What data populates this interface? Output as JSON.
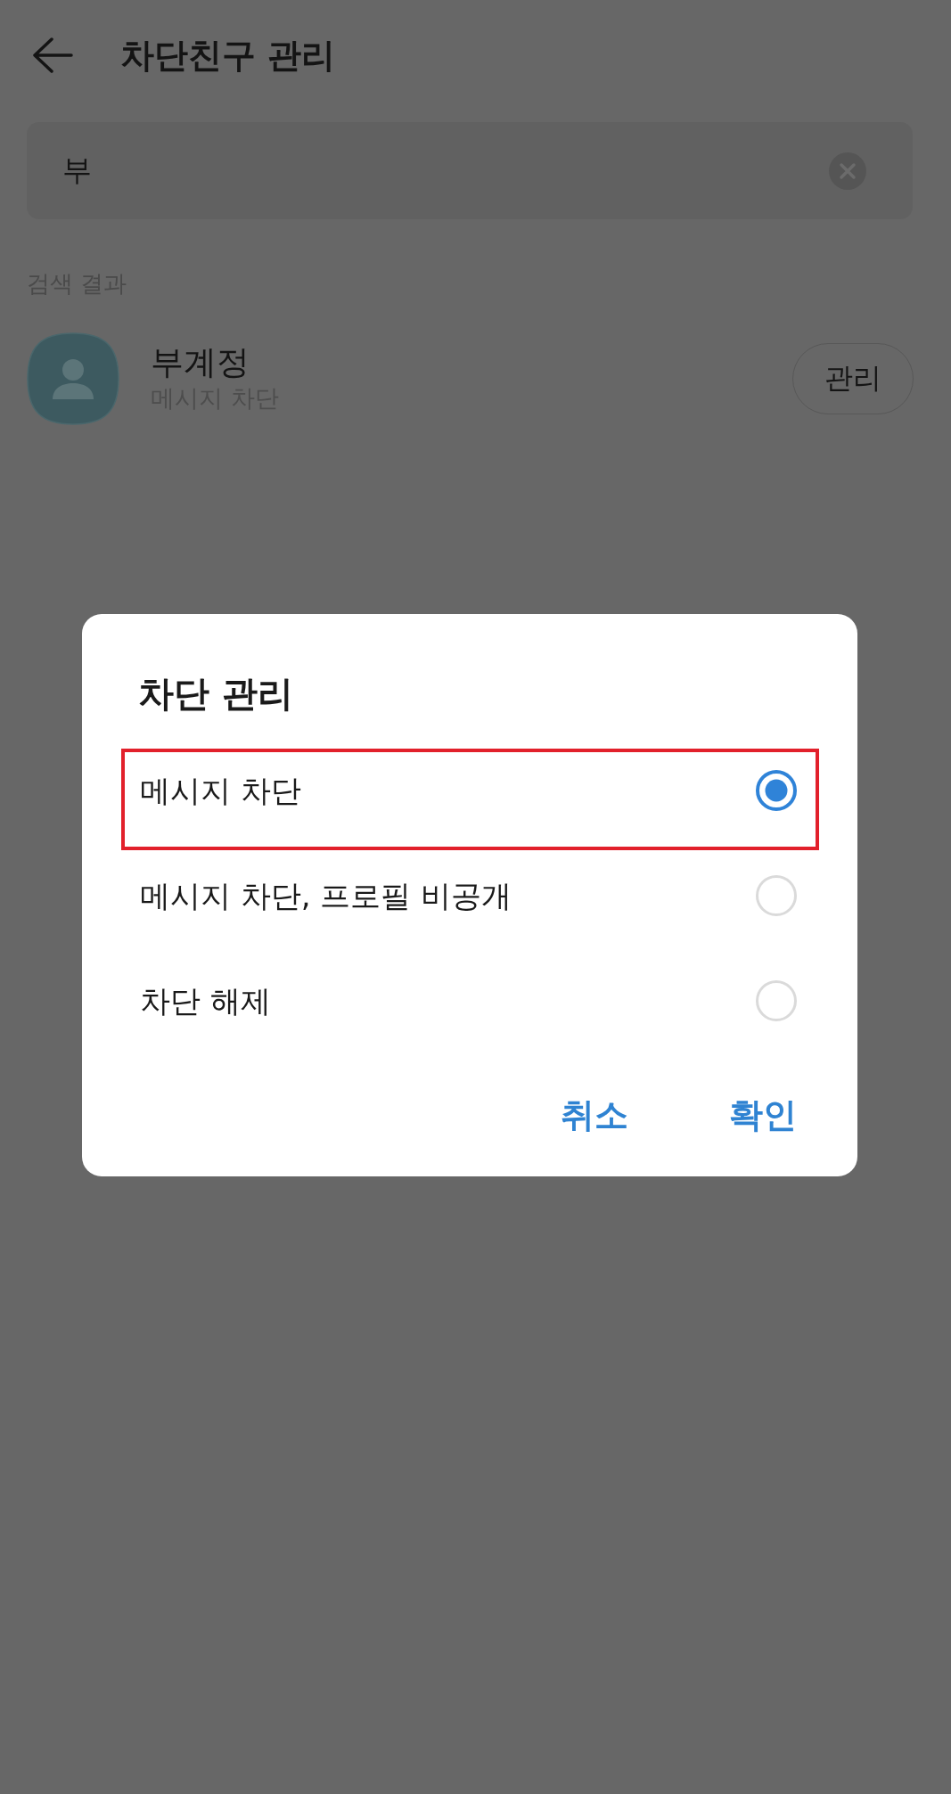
{
  "header": {
    "title": "차단친구 관리"
  },
  "search": {
    "value": "부"
  },
  "results": {
    "heading": "검색 결과",
    "items": [
      {
        "name": "부계정",
        "status": "메시지 차단",
        "action": "관리"
      }
    ]
  },
  "dialog": {
    "title": "차단 관리",
    "options": [
      {
        "label": "메시지 차단",
        "selected": true,
        "highlighted": true
      },
      {
        "label": "메시지 차단, 프로필 비공개",
        "selected": false,
        "highlighted": false
      },
      {
        "label": "차단 해제",
        "selected": false,
        "highlighted": false
      }
    ],
    "buttons": [
      "취소",
      "확인"
    ]
  }
}
